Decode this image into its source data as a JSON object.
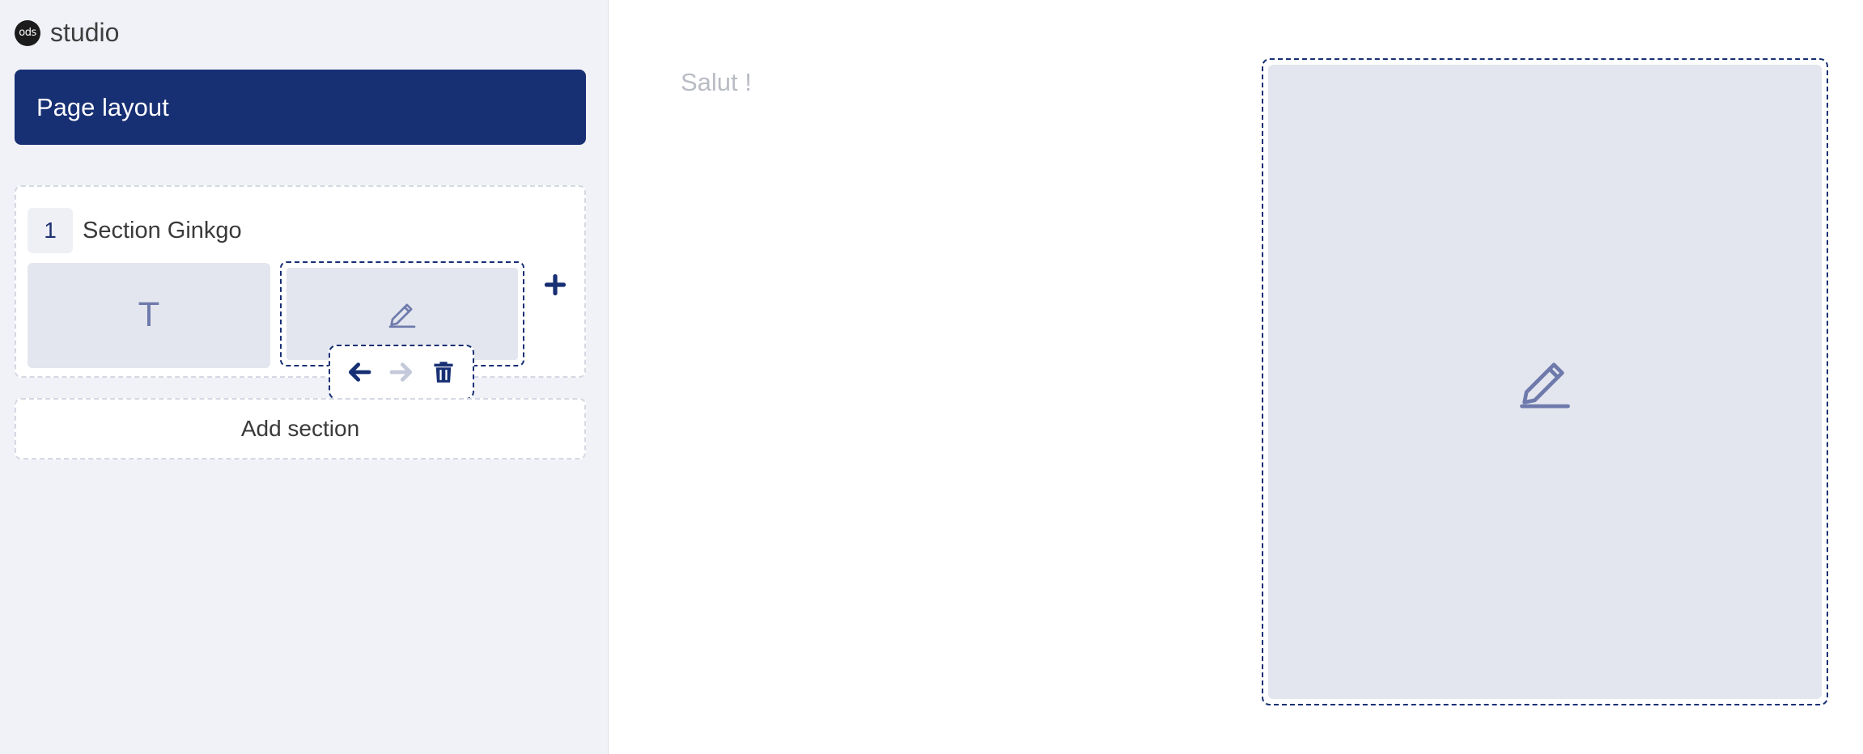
{
  "app": {
    "logo_mark": "ods",
    "title": "studio"
  },
  "sidebar": {
    "page_layout_label": "Page layout",
    "sections": [
      {
        "number": "1",
        "name": "Section Ginkgo",
        "blocks": [
          {
            "type": "text",
            "glyph": "T",
            "icon": "text-icon"
          },
          {
            "type": "edit",
            "icon": "pencil-icon",
            "selected": true
          }
        ]
      }
    ],
    "block_toolbar": {
      "actions": [
        "move-left-icon",
        "move-right-icon",
        "trash-icon"
      ]
    },
    "add_block_icon": "plus-icon",
    "add_section_label": "Add section"
  },
  "main": {
    "greeting": "Salut !",
    "preview_icon": "pencil-icon"
  },
  "colors": {
    "primary": "#172f73",
    "sidebar_bg": "#f0f2f7",
    "block_bg": "#e3e6ee",
    "icon_muted": "#6e7aab",
    "placeholder_text": "#b9bcc4",
    "disabled": "#c4c9da"
  }
}
